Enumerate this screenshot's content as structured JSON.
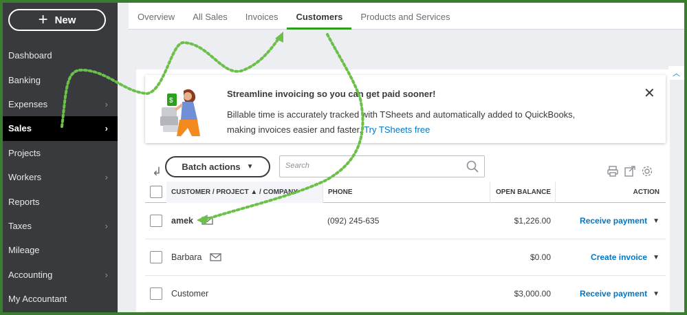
{
  "sidebar": {
    "new_label": "New",
    "items": [
      {
        "label": "Dashboard",
        "chevron": false
      },
      {
        "label": "Banking",
        "chevron": false
      },
      {
        "label": "Expenses",
        "chevron": true
      },
      {
        "label": "Sales",
        "chevron": true,
        "active": true
      },
      {
        "label": "Projects",
        "chevron": false
      },
      {
        "label": "Workers",
        "chevron": true
      },
      {
        "label": "Reports",
        "chevron": false
      },
      {
        "label": "Taxes",
        "chevron": true
      },
      {
        "label": "Mileage",
        "chevron": false
      },
      {
        "label": "Accounting",
        "chevron": true
      },
      {
        "label": "My Accountant",
        "chevron": false
      }
    ]
  },
  "tabs": [
    {
      "label": "Overview"
    },
    {
      "label": "All Sales"
    },
    {
      "label": "Invoices"
    },
    {
      "label": "Customers",
      "active": true
    },
    {
      "label": "Products and Services"
    }
  ],
  "promo": {
    "title": "Streamline invoicing so you can get paid sooner!",
    "text": "Billable time is accurately tracked with TSheets and automatically added to QuickBooks, making invoices easier and faster.",
    "link": "Try TSheets free"
  },
  "toolbar": {
    "batch_label": "Batch actions",
    "search_placeholder": "Search"
  },
  "table": {
    "headers": {
      "name": "CUSTOMER / PROJECT ▲ / COMPANY",
      "phone": "PHONE",
      "balance": "OPEN BALANCE",
      "action": "ACTION"
    },
    "rows": [
      {
        "name": "amek",
        "phone": "(092) 245-635",
        "balance": "$1,226.00",
        "action": "Receive payment"
      },
      {
        "name": "Barbara",
        "phone": "",
        "balance": "$0.00",
        "action": "Create invoice"
      },
      {
        "name": "Customer",
        "phone": "",
        "balance": "$3,000.00",
        "action": "Receive payment"
      }
    ]
  },
  "colors": {
    "sidebar_bg": "#393a3d",
    "accent_green": "#2ca01c",
    "link_blue": "#0077c5",
    "annotation_green": "#6cc04a",
    "frame_border": "#3a7d2e"
  }
}
